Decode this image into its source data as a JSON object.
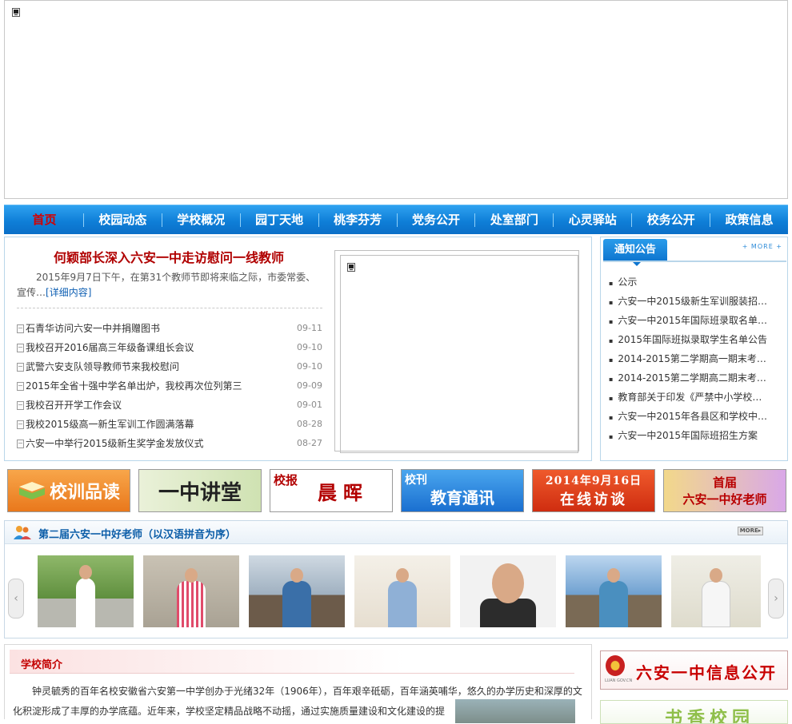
{
  "nav": {
    "items": [
      "首页",
      "校园动态",
      "学校概况",
      "园丁天地",
      "桃李芬芳",
      "党务公开",
      "处室部门",
      "心灵驿站",
      "校务公开",
      "政策信息"
    ]
  },
  "news": {
    "headline": "何颖部长深入六安一中走访慰问一线教师",
    "summary": "2015年9月7日下午，在第31个教师节即将来临之际，市委常委、宣传…",
    "detail_link": "[详细内容]",
    "items": [
      {
        "title": "石青华访问六安一中并捐赠图书",
        "date": "09-11"
      },
      {
        "title": "我校召开2016届高三年级备课组长会议",
        "date": "09-10"
      },
      {
        "title": "武警六安支队领导教师节来我校慰问",
        "date": "09-10"
      },
      {
        "title": "2015年全省十强中学名单出炉，我校再次位列第三",
        "date": "09-09"
      },
      {
        "title": "我校召开开学工作会议",
        "date": "09-01"
      },
      {
        "title": "我校2015级高一新生军训工作圆满落幕",
        "date": "08-28"
      },
      {
        "title": "六安一中举行2015级新生奖学金发放仪式",
        "date": "08-27"
      }
    ]
  },
  "notice": {
    "tab": "通知公告",
    "more": "+ MORE +",
    "items": [
      "公示",
      "六安一中2015级新生军训服装招…",
      "六安一中2015年国际班录取名单…",
      "2015年国际班拟录取学生名单公告",
      "2014-2015第二学期高一期末考…",
      "2014-2015第二学期高二期末考…",
      "教育部关于印发《严禁中小学校…",
      "六安一中2015年各县区和学校中…",
      "六安一中2015年国际班招生方案"
    ]
  },
  "promos": {
    "p1": "校训品读",
    "p2": "一中讲堂",
    "p3_small": "校报",
    "p3_big": "晨晖",
    "p4_small": "校刊",
    "p4_big": "教育通讯",
    "p5_line1": "2014年9月16日",
    "p5_line2": "在线访谈",
    "p6_line1": "首届",
    "p6_line2": "六安一中好老师"
  },
  "teachers": {
    "title": "第二届六安一中好老师（以汉语拼音为序）",
    "more": "MORE▸"
  },
  "intro": {
    "title": "学校简介",
    "text": "钟灵毓秀的百年名校安徽省六安第一中学创办于光绪32年（1906年），百年艰辛砥砺，百年涵英哺华，悠久的办学历史和深厚的文化积淀形成了丰厚的办学底蕴。近年来，学校坚定精品战略不动摇，通过实施质量建设和文化建设的提"
  },
  "side": {
    "info_title": "六安一中信息公开",
    "emblem_text": "LUAN GOV.CN",
    "book_title": "书香校园"
  }
}
